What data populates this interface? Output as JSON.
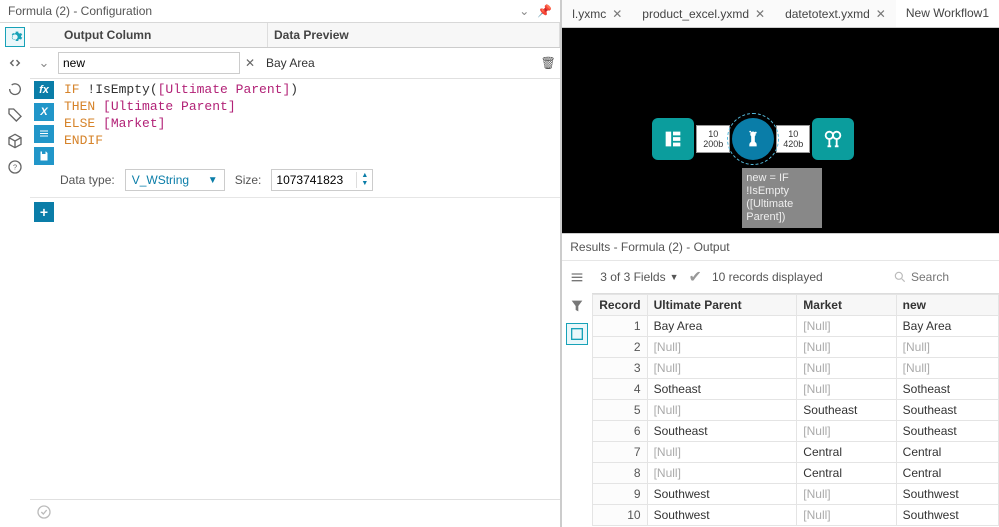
{
  "panel": {
    "title": "Formula (2) - Configuration"
  },
  "headers": {
    "output_column": "Output Column",
    "data_preview": "Data Preview"
  },
  "output": {
    "name": "new",
    "preview": "Bay Area"
  },
  "formula": {
    "line1_kw": "IF ",
    "line1_fn": "!IsEmpty(",
    "line1_col": "[Ultimate Parent]",
    "line1_close": ")",
    "line2_kw": "THEN ",
    "line2_col": "[Ultimate Parent]",
    "line3_kw": "ELSE ",
    "line3_col": "[Market]",
    "line4_kw": "ENDIF"
  },
  "datatype": {
    "label": "Data type:",
    "value": "V_WString",
    "size_label": "Size:",
    "size_value": "1073741823"
  },
  "tabs": {
    "t0": "l.yxmc",
    "t1": "product_excel.yxmd",
    "t2": "datetotext.yxmd",
    "t3": "New Workflow1"
  },
  "canvas": {
    "stub1_top": "10",
    "stub1_bot": "200b",
    "stub2_top": "10",
    "stub2_bot": "420b",
    "annotation": "new = IF !IsEmpty ([Ultimate Parent])"
  },
  "results": {
    "title": "Results - Formula (2) - Output",
    "fields_summary": "3 of 3 Fields",
    "records_summary": "10 records displayed",
    "search_placeholder": "Search",
    "columns": {
      "record": "Record",
      "ultimate_parent": "Ultimate Parent",
      "market": "Market",
      "new": "new"
    },
    "rows": [
      {
        "record": "1",
        "ultimate_parent": "Bay Area",
        "market": "[Null]",
        "new": "Bay Area",
        "up_null": false,
        "mk_null": true,
        "nw_null": false
      },
      {
        "record": "2",
        "ultimate_parent": "[Null]",
        "market": "[Null]",
        "new": "[Null]",
        "up_null": true,
        "mk_null": true,
        "nw_null": true
      },
      {
        "record": "3",
        "ultimate_parent": "[Null]",
        "market": "[Null]",
        "new": "[Null]",
        "up_null": true,
        "mk_null": true,
        "nw_null": true
      },
      {
        "record": "4",
        "ultimate_parent": "Sotheast",
        "market": "[Null]",
        "new": "Sotheast",
        "up_null": false,
        "mk_null": true,
        "nw_null": false
      },
      {
        "record": "5",
        "ultimate_parent": "[Null]",
        "market": "Southeast",
        "new": "Southeast",
        "up_null": true,
        "mk_null": false,
        "nw_null": false
      },
      {
        "record": "6",
        "ultimate_parent": "Southeast",
        "market": "[Null]",
        "new": "Southeast",
        "up_null": false,
        "mk_null": true,
        "nw_null": false
      },
      {
        "record": "7",
        "ultimate_parent": "[Null]",
        "market": "Central",
        "new": "Central",
        "up_null": true,
        "mk_null": false,
        "nw_null": false
      },
      {
        "record": "8",
        "ultimate_parent": "[Null]",
        "market": "Central",
        "new": "Central",
        "up_null": true,
        "mk_null": false,
        "nw_null": false
      },
      {
        "record": "9",
        "ultimate_parent": "Southwest",
        "market": "[Null]",
        "new": "Southwest",
        "up_null": false,
        "mk_null": true,
        "nw_null": false
      },
      {
        "record": "10",
        "ultimate_parent": "Southwest",
        "market": "[Null]",
        "new": "Southwest",
        "up_null": false,
        "mk_null": true,
        "nw_null": false
      }
    ]
  }
}
